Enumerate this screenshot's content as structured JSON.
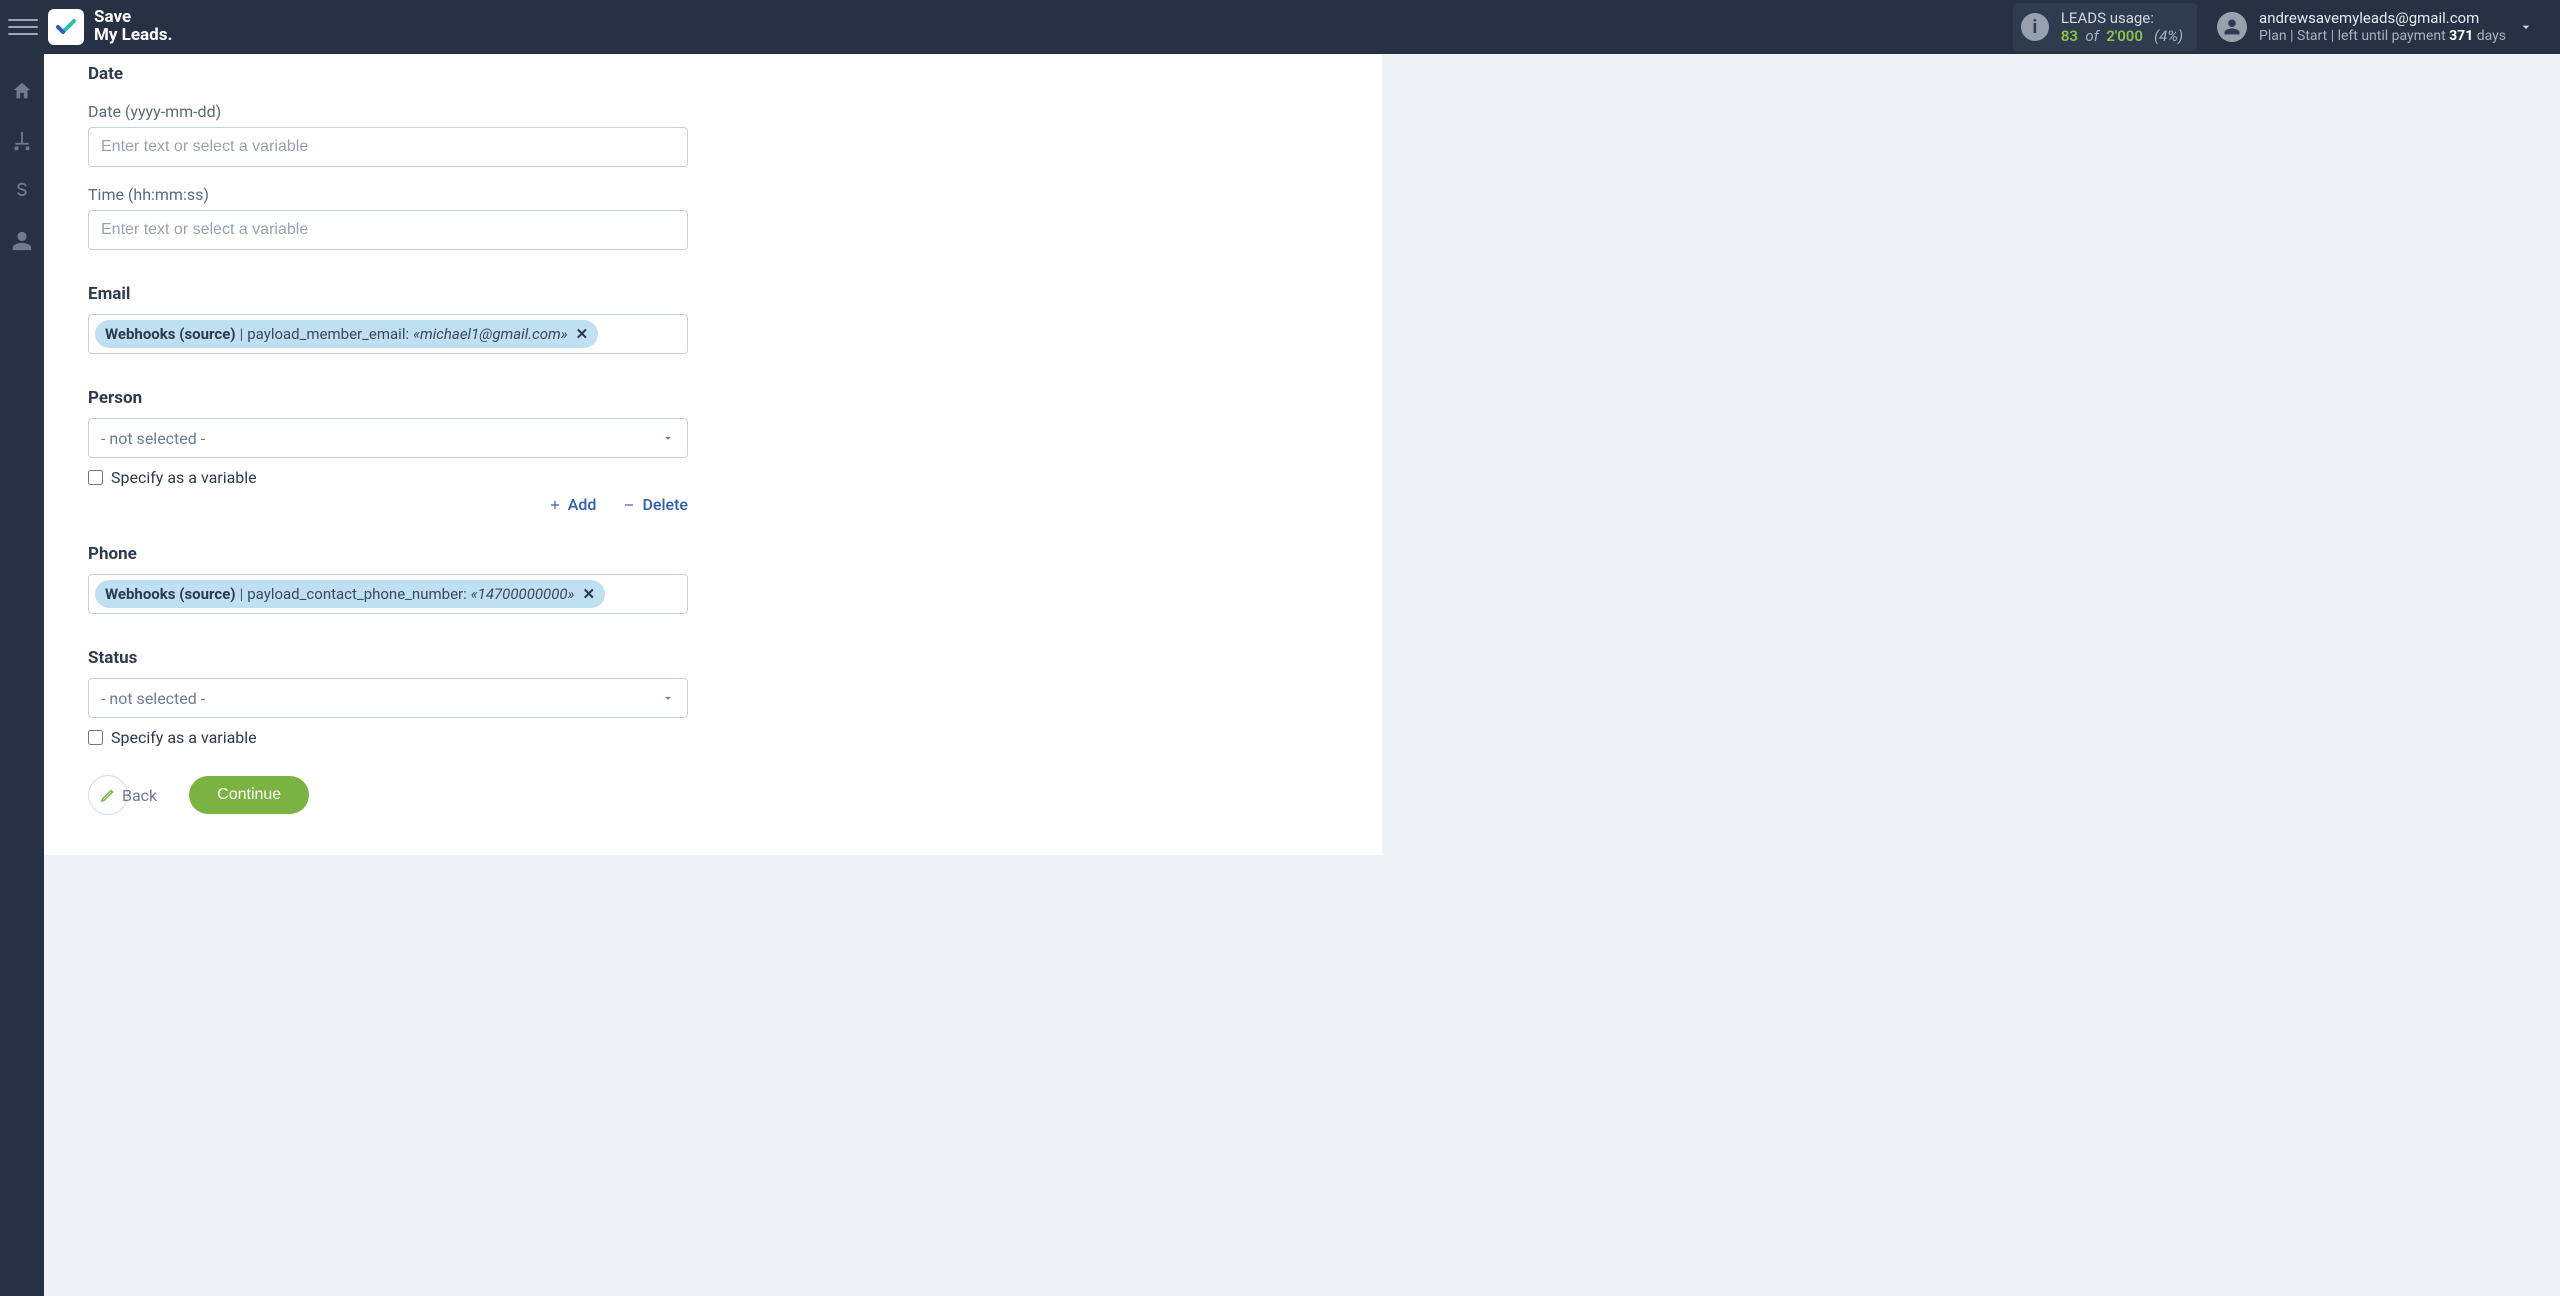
{
  "topbar": {
    "logo_text": "Save\nMy Leads.",
    "usage": {
      "title": "LEADS usage:",
      "current": "83",
      "of_word": "of",
      "total": "2'000",
      "percent": "(4%)"
    },
    "account": {
      "email": "andrewsavemyleads@gmail.com",
      "plan_label": "Plan",
      "plan_name": "Start",
      "rest_before": " left until payment ",
      "days_count": "371",
      "days_word": " days"
    }
  },
  "form": {
    "date_section_title": "Date",
    "date_label": "Date (yyyy-mm-dd)",
    "date_placeholder": "Enter text or select a variable",
    "time_label": "Time (hh:mm:ss)",
    "time_placeholder": "Enter text or select a variable",
    "email_section_title": "Email",
    "email_chip": {
      "source": "Webhooks (source)",
      "sep": " | ",
      "key": "payload_member_email: ",
      "value": "«michael1@gmail.com»"
    },
    "person_section_title": "Person",
    "person_select_placeholder": "- not selected -",
    "specify_as_variable": "Specify as a variable",
    "action_add": "Add",
    "action_delete": "Delete",
    "phone_section_title": "Phone",
    "phone_chip": {
      "source": "Webhooks (source)",
      "sep": " | ",
      "key": "payload_contact_phone_number: ",
      "value": "«14700000000»"
    },
    "status_section_title": "Status",
    "status_select_placeholder": "- not selected -",
    "back_label": "Back",
    "continue_label": "Continue"
  }
}
